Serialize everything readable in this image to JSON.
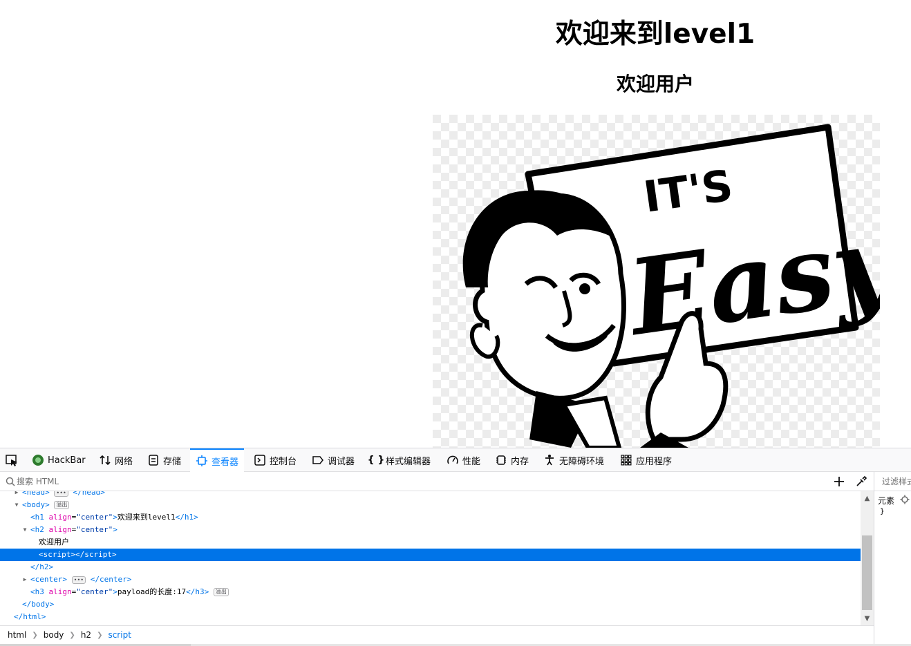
{
  "page": {
    "h1": "欢迎来到level1",
    "h2": "欢迎用户",
    "image_text_top": "IT'S",
    "image_text_main": "Easy"
  },
  "devtools": {
    "tabs": [
      {
        "label": "HackBar",
        "icon": "hackbar-icon"
      },
      {
        "label": "网络",
        "icon": "network-icon"
      },
      {
        "label": "存储",
        "icon": "storage-icon"
      },
      {
        "label": "查看器",
        "icon": "inspector-icon",
        "selected": true
      },
      {
        "label": "控制台",
        "icon": "console-icon"
      },
      {
        "label": "调试器",
        "icon": "debugger-icon"
      },
      {
        "label": "样式编辑器",
        "icon": "style-editor-icon"
      },
      {
        "label": "性能",
        "icon": "performance-icon"
      },
      {
        "label": "内存",
        "icon": "memory-icon"
      },
      {
        "label": "无障碍环境",
        "icon": "accessibility-icon"
      },
      {
        "label": "应用程序",
        "icon": "application-icon"
      }
    ],
    "search_placeholder": "搜索 HTML",
    "tree": {
      "head_tag": "head",
      "body_tag": "body",
      "body_badge": "溢出",
      "h1_tag": "h1",
      "align_attr": "align",
      "center_val": "\"center\"",
      "h1_text": "欢迎来到level1",
      "h2_tag": "h2",
      "h2_text": "欢迎用户",
      "script_tag": "script",
      "center_tag": "center",
      "h3_tag": "h3",
      "h3_text": "payload的长度:17",
      "h3_badge": "溢出",
      "html_tag": "html",
      "dots": "•••"
    },
    "breadcrumbs": [
      "html",
      "body",
      "h2",
      "script"
    ],
    "sidepanel": {
      "filter_label": "过滤样式",
      "rule_label": "元素",
      "rule_close": "}"
    },
    "colors": {
      "accent": "#0a84ff",
      "selected_row": "#0074e8",
      "tag": "#0074e8",
      "attr": "#dd00a9",
      "attr_value": "#003eaa"
    }
  }
}
